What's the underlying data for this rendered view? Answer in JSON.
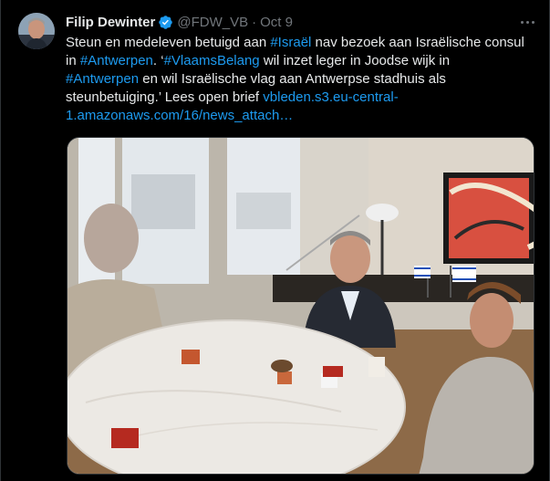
{
  "tweet": {
    "author_name": "Filip Dewinter",
    "handle": "@FDW_VB",
    "separator": "·",
    "time": "Oct 9",
    "text_lines": [
      [
        {
          "t": "Steun en medeleven betuigd aan ",
          "link": false
        },
        {
          "t": "#Israël",
          "link": true
        },
        {
          "t": " nav bezoek aan Israëlische consul",
          "link": false
        }
      ],
      [
        {
          "t": "in ",
          "link": false
        },
        {
          "t": "#Antwerpen",
          "link": true
        },
        {
          "t": ". ‘",
          "link": false
        },
        {
          "t": "#VlaamsBelang",
          "link": true
        },
        {
          "t": " wil inzet leger in Joodse wijk in",
          "link": false
        }
      ],
      [
        {
          "t": "#Antwerpen",
          "link": true
        },
        {
          "t": " en wil Israëlische vlag aan Antwerpse stadhuis als",
          "link": false
        }
      ],
      [
        {
          "t": "steunbetuiging.’ Lees open brief ",
          "link": false
        },
        {
          "t": "vbleden.s3.eu-central-",
          "link": true
        }
      ],
      [
        {
          "t": "1.amazonaws.com/16/news_attach…",
          "link": true
        }
      ]
    ]
  },
  "icons": {
    "verified": "verified-badge-icon",
    "more": "more-options-icon"
  },
  "colors": {
    "background": "#000000",
    "text": "#e7e9ea",
    "muted": "#71767b",
    "link": "#1d9bf0",
    "border": "#2f3336"
  }
}
